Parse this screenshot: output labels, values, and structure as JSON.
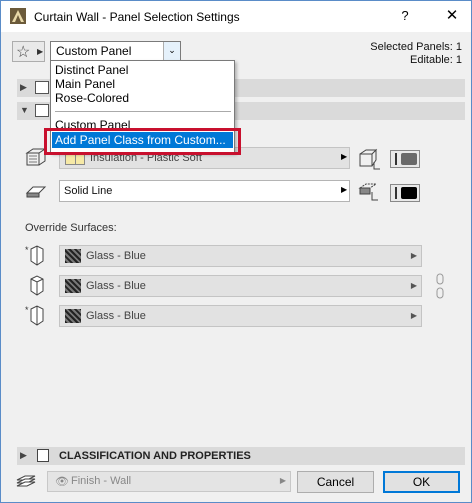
{
  "window": {
    "title": "Curtain Wall - Panel Selection Settings",
    "help_label": "?",
    "close_label": "✕"
  },
  "header": {
    "combo_value": "Custom Panel",
    "selected_panels": "Selected Panels: 1",
    "editable": "Editable: 1"
  },
  "dropdown": {
    "items": [
      "Distinct Panel",
      "Main Panel",
      "Rose-Colored"
    ],
    "custom": "Custom Panel",
    "add_class": "Add Panel Class from Custom..."
  },
  "settings": {
    "material": "Insulation - Plastic Soft",
    "line_type": "Solid Line"
  },
  "override": {
    "label": "Override Surfaces:",
    "surfaces": [
      "Glass - Blue",
      "Glass - Blue",
      "Glass - Blue"
    ]
  },
  "sections": {
    "classification": "CLASSIFICATION AND PROPERTIES"
  },
  "footer": {
    "layer": "Finish - Wall",
    "cancel_label": "Cancel",
    "ok_label": "OK"
  },
  "colors": {
    "accent": "#0078d7",
    "highlight_border": "#c8102e"
  }
}
